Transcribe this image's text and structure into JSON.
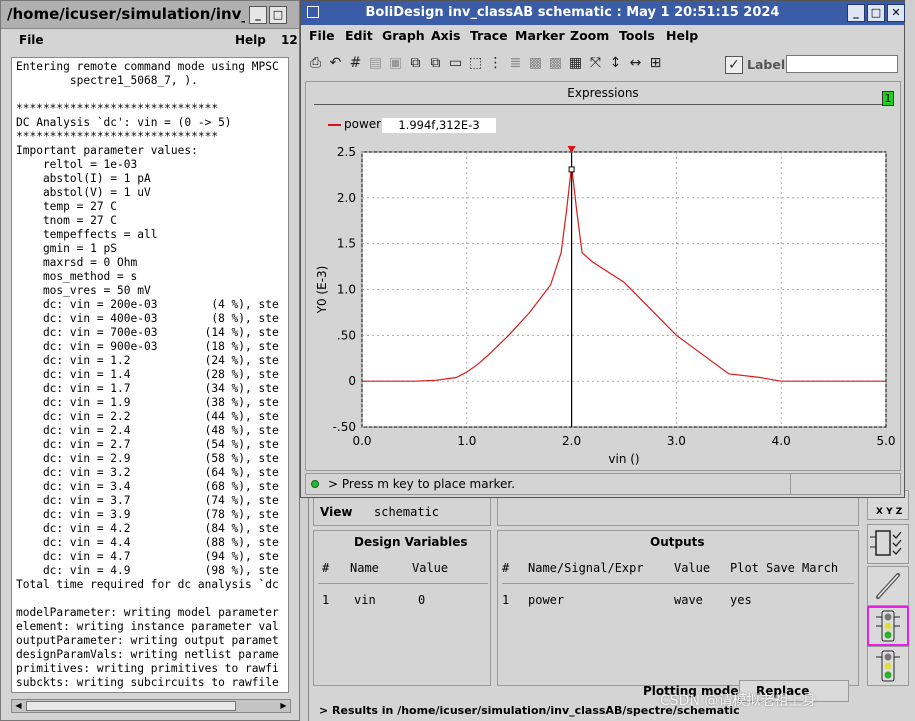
{
  "terminal": {
    "title": "/home/icuser/simulation/inv_",
    "menu": {
      "file": "File",
      "help": "Help",
      "extra": "12"
    },
    "lines": [
      "Entering remote command mode using MPSC",
      "        spectre1_5068_7, ).",
      "",
      "******************************",
      "DC Analysis `dc': vin = (0 -> 5)",
      "******************************",
      "Important parameter values:",
      "    reltol = 1e-03",
      "    abstol(I) = 1 pA",
      "    abstol(V) = 1 uV",
      "    temp = 27 C",
      "    tnom = 27 C",
      "    tempeffects = all",
      "    gmin = 1 pS",
      "    maxrsd = 0 Ohm",
      "    mos_method = s",
      "    mos_vres = 50 mV",
      "    dc: vin = 200e-03        (4 %), ste",
      "    dc: vin = 400e-03        (8 %), ste",
      "    dc: vin = 700e-03       (14 %), ste",
      "    dc: vin = 900e-03       (18 %), ste",
      "    dc: vin = 1.2           (24 %), ste",
      "    dc: vin = 1.4           (28 %), ste",
      "    dc: vin = 1.7           (34 %), ste",
      "    dc: vin = 1.9           (38 %), ste",
      "    dc: vin = 2.2           (44 %), ste",
      "    dc: vin = 2.4           (48 %), ste",
      "    dc: vin = 2.7           (54 %), ste",
      "    dc: vin = 2.9           (58 %), ste",
      "    dc: vin = 3.2           (64 %), ste",
      "    dc: vin = 3.4           (68 %), ste",
      "    dc: vin = 3.7           (74 %), ste",
      "    dc: vin = 3.9           (78 %), ste",
      "    dc: vin = 4.2           (84 %), ste",
      "    dc: vin = 4.4           (88 %), ste",
      "    dc: vin = 4.7           (94 %), ste",
      "    dc: vin = 4.9           (98 %), ste",
      "Total time required for dc analysis `dc",
      "",
      "modelParameter: writing model parameter",
      "element: writing instance parameter val",
      "outputParameter: writing output paramet",
      "designParamVals: writing netlist parame",
      "primitives: writing primitives to rawfi",
      "subckts: writing subcircuits to rawfile"
    ]
  },
  "wave": {
    "title": "BoliDesign inv_classAB schematic : May  1 20:51:15 2024",
    "menu": [
      "File",
      "Edit",
      "Graph",
      "Axis",
      "Trace",
      "Marker",
      "Zoom",
      "Tools",
      "Help"
    ],
    "label_toggle": "Label",
    "label_input_value": "",
    "expressions_label": "Expressions",
    "expressions_badge": "1",
    "legend": {
      "name": "power",
      "value": "1.994f,312E-3"
    },
    "status": "> Press m key to place marker."
  },
  "ade": {
    "view_label": "View",
    "view_value": "schematic",
    "design_vars": {
      "title": "Design Variables",
      "headers": [
        "#",
        "Name",
        "Value"
      ],
      "rows": [
        [
          "1",
          "vin",
          "0"
        ]
      ]
    },
    "outputs": {
      "title": "Outputs",
      "headers": [
        "#",
        "Name/Signal/Expr",
        "Value",
        "Plot",
        "Save",
        "March"
      ],
      "rows": [
        [
          "1",
          "power",
          "wave",
          "yes",
          "",
          ""
        ]
      ]
    },
    "plotting_mode_label": "Plotting mode:",
    "plotting_mode_value": "Replace",
    "results_text": "> Results in /home/icuser/simulation/inv_classAB/spectre/schematic",
    "xyz_label": "X Y Z"
  },
  "watermark": "CSDN @请模拟老祖上身",
  "chart_data": {
    "type": "line",
    "xlabel": "vin ()",
    "ylabel": "Y0 (E-3)",
    "xlim": [
      0,
      5
    ],
    "ylim": [
      -0.5,
      2.5
    ],
    "xticks": [
      "0.0",
      "1.0",
      "2.0",
      "3.0",
      "4.0",
      "5.0"
    ],
    "yticks": [
      "-.50",
      "0",
      ".50",
      "1.0",
      "1.5",
      "2.0",
      "2.5"
    ],
    "grid": true,
    "series": [
      {
        "name": "power",
        "color": "#d81b1b",
        "x": [
          0,
          0.5,
          0.7,
          0.9,
          1.0,
          1.1,
          1.2,
          1.4,
          1.6,
          1.8,
          1.9,
          1.95,
          2.0,
          2.05,
          2.1,
          2.2,
          2.5,
          3.0,
          3.5,
          3.8,
          4.0,
          5.0
        ],
        "y": [
          0,
          0,
          0.01,
          0.04,
          0.1,
          0.18,
          0.28,
          0.5,
          0.75,
          1.05,
          1.4,
          1.85,
          2.35,
          1.85,
          1.4,
          1.3,
          1.08,
          0.5,
          0.08,
          0.04,
          0,
          0
        ]
      }
    ],
    "marker": {
      "x": 2.0,
      "y": 2.31
    }
  }
}
